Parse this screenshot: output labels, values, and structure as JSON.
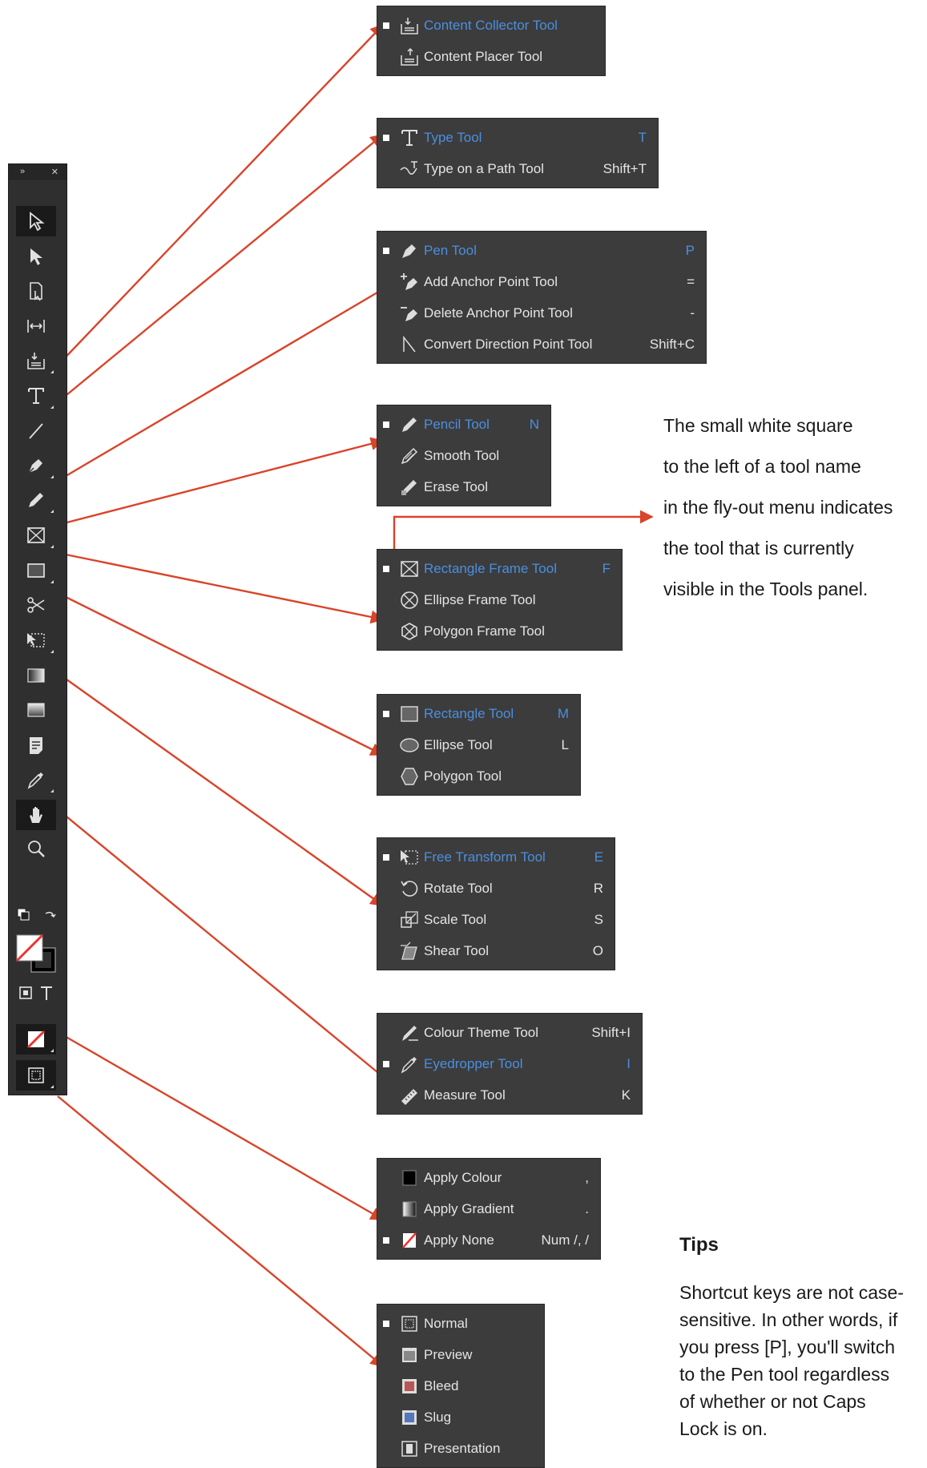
{
  "panel": {
    "header_left": "»",
    "header_right": "✕",
    "tools": [
      {
        "name": "selection-tool-button",
        "icon": "selection-arrow-icon"
      },
      {
        "name": "direct-selection-tool-button",
        "icon": "direct-selection-arrow-icon"
      },
      {
        "name": "page-tool-button",
        "icon": "page-tool-icon"
      },
      {
        "name": "gap-tool-button",
        "icon": "gap-tool-icon"
      },
      {
        "name": "content-collector-tool-button",
        "icon": "content-collector-icon"
      },
      {
        "name": "type-tool-button",
        "icon": "type-icon"
      },
      {
        "name": "line-tool-button",
        "icon": "line-icon"
      },
      {
        "name": "pen-tool-button",
        "icon": "pen-icon"
      },
      {
        "name": "pencil-tool-button",
        "icon": "pencil-icon"
      },
      {
        "name": "rectangle-frame-tool-button",
        "icon": "rectangle-frame-icon"
      },
      {
        "name": "rectangle-tool-button",
        "icon": "rectangle-icon"
      },
      {
        "name": "scissors-tool-button",
        "icon": "scissors-icon"
      },
      {
        "name": "free-transform-tool-button",
        "icon": "free-transform-icon"
      },
      {
        "name": "gradient-swatch-tool-button",
        "icon": "gradient-swatch-icon"
      },
      {
        "name": "gradient-feather-tool-button",
        "icon": "gradient-feather-icon"
      },
      {
        "name": "note-tool-button",
        "icon": "note-icon"
      },
      {
        "name": "eyedropper-tool-button",
        "icon": "eyedropper-icon"
      },
      {
        "name": "hand-tool-button",
        "icon": "hand-icon"
      },
      {
        "name": "zoom-tool-button",
        "icon": "zoom-icon"
      }
    ]
  },
  "flyouts": [
    {
      "id": "content",
      "items": [
        {
          "label": "Content Collector Tool",
          "key": "",
          "active": true,
          "icon": "content-collector-icon"
        },
        {
          "label": "Content Placer Tool",
          "key": "",
          "active": false,
          "icon": "content-placer-icon"
        }
      ]
    },
    {
      "id": "type",
      "items": [
        {
          "label": "Type Tool",
          "key": "T",
          "active": true,
          "icon": "type-icon"
        },
        {
          "label": "Type on a Path Tool",
          "key": "Shift+T",
          "active": false,
          "icon": "type-on-path-icon"
        }
      ]
    },
    {
      "id": "pen",
      "items": [
        {
          "label": "Pen Tool",
          "key": "P",
          "active": true,
          "icon": "pen-icon"
        },
        {
          "label": "Add Anchor Point Tool",
          "key": "=",
          "active": false,
          "icon": "add-anchor-icon"
        },
        {
          "label": "Delete Anchor Point Tool",
          "key": "-",
          "active": false,
          "icon": "delete-anchor-icon"
        },
        {
          "label": "Convert Direction Point Tool",
          "key": "Shift+C",
          "active": false,
          "icon": "convert-direction-icon"
        }
      ]
    },
    {
      "id": "pencil",
      "items": [
        {
          "label": "Pencil Tool",
          "key": "N",
          "active": true,
          "icon": "pencil-icon"
        },
        {
          "label": "Smooth Tool",
          "key": "",
          "active": false,
          "icon": "smooth-icon"
        },
        {
          "label": "Erase Tool",
          "key": "",
          "active": false,
          "icon": "erase-icon"
        }
      ]
    },
    {
      "id": "frame",
      "items": [
        {
          "label": "Rectangle Frame Tool",
          "key": "F",
          "active": true,
          "icon": "rectangle-frame-icon"
        },
        {
          "label": "Ellipse Frame Tool",
          "key": "",
          "active": false,
          "icon": "ellipse-frame-icon"
        },
        {
          "label": "Polygon Frame Tool",
          "key": "",
          "active": false,
          "icon": "polygon-frame-icon"
        }
      ]
    },
    {
      "id": "shape",
      "items": [
        {
          "label": "Rectangle Tool",
          "key": "M",
          "active": true,
          "icon": "rectangle-icon"
        },
        {
          "label": "Ellipse Tool",
          "key": "L",
          "active": false,
          "icon": "ellipse-icon"
        },
        {
          "label": "Polygon Tool",
          "key": "",
          "active": false,
          "icon": "polygon-icon"
        }
      ]
    },
    {
      "id": "transform",
      "items": [
        {
          "label": "Free Transform Tool",
          "key": "E",
          "active": true,
          "icon": "free-transform-icon"
        },
        {
          "label": "Rotate Tool",
          "key": "R",
          "active": false,
          "icon": "rotate-icon"
        },
        {
          "label": "Scale Tool",
          "key": "S",
          "active": false,
          "icon": "scale-icon"
        },
        {
          "label": "Shear Tool",
          "key": "O",
          "active": false,
          "icon": "shear-icon"
        }
      ]
    },
    {
      "id": "eyedropper",
      "items": [
        {
          "label": "Colour Theme Tool",
          "key": "Shift+I",
          "active": false,
          "icon": "colour-theme-icon"
        },
        {
          "label": "Eyedropper Tool",
          "key": "I",
          "active": true,
          "icon": "eyedropper-icon"
        },
        {
          "label": "Measure Tool",
          "key": "K",
          "active": false,
          "icon": "measure-icon"
        }
      ]
    },
    {
      "id": "apply",
      "items": [
        {
          "label": "Apply Colour",
          "key": ",",
          "active": false,
          "icon": "apply-colour-icon"
        },
        {
          "label": "Apply Gradient",
          "key": ".",
          "active": false,
          "icon": "apply-gradient-icon"
        },
        {
          "label": "Apply None",
          "key": "Num /, /",
          "active": false,
          "icon": "apply-none-icon"
        }
      ]
    },
    {
      "id": "view",
      "items": [
        {
          "label": "Normal",
          "key": "",
          "active": false,
          "icon": "normal-mode-icon"
        },
        {
          "label": "Preview",
          "key": "",
          "active": false,
          "icon": "preview-mode-icon"
        },
        {
          "label": "Bleed",
          "key": "",
          "active": false,
          "icon": "bleed-mode-icon"
        },
        {
          "label": "Slug",
          "key": "",
          "active": false,
          "icon": "slug-mode-icon"
        },
        {
          "label": "Presentation",
          "key": "",
          "active": false,
          "icon": "presentation-mode-icon"
        }
      ]
    }
  ],
  "annotation": {
    "note_lines": [
      "The small white square",
      "to the left of a tool name",
      "in the fly-out menu indicates",
      "the tool that is currently",
      "visible in the Tools panel."
    ],
    "tips_title": "Tips",
    "tips_lines": [
      "Shortcut keys are not case-",
      "sensitive. In other words, if",
      "you press [P], you'll switch",
      "to the Pen tool regardless",
      "of whether or not Caps",
      "Lock is on."
    ]
  },
  "colors": {
    "arrow": "#d9442a",
    "active_text": "#4a8fe0",
    "panel_bg": "#2f2f2f",
    "menu_bg": "#3c3c3c"
  }
}
